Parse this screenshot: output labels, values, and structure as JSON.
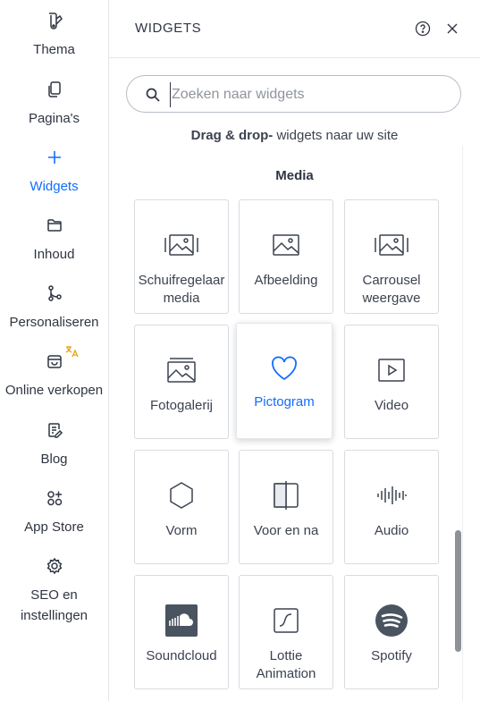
{
  "sidebar": {
    "items": [
      {
        "label": "Thema",
        "icon": "theme-icon"
      },
      {
        "label": "Pagina's",
        "icon": "pages-icon"
      },
      {
        "label": "Widgets",
        "icon": "plus-icon",
        "active": true
      },
      {
        "label": "Inhoud",
        "icon": "folder-icon"
      },
      {
        "label": "Personaliseren",
        "icon": "branch-icon"
      },
      {
        "label": "Online verkopen",
        "icon": "store-icon"
      },
      {
        "label": "Blog",
        "icon": "blog-icon"
      },
      {
        "label": "App Store",
        "icon": "apps-icon"
      },
      {
        "label": "SEO en instellingen",
        "icon": "gear-icon"
      }
    ]
  },
  "panel": {
    "title": "WIDGETS",
    "search_placeholder": "Zoeken naar widgets",
    "hint_bold": "Drag & drop-",
    "hint_rest": " widgets naar uw site",
    "section_title": "Media",
    "widgets": [
      {
        "label": "Schuifregelaar media",
        "icon": "slider-media-icon"
      },
      {
        "label": "Afbeelding",
        "icon": "image-icon"
      },
      {
        "label": "Carrousel weergave",
        "icon": "carousel-icon"
      },
      {
        "label": "Fotogalerij",
        "icon": "gallery-icon"
      },
      {
        "label": "Pictogram",
        "icon": "heart-icon",
        "selected": true
      },
      {
        "label": "Video",
        "icon": "video-icon"
      },
      {
        "label": "Vorm",
        "icon": "hexagon-icon"
      },
      {
        "label": "Voor en na",
        "icon": "before-after-icon"
      },
      {
        "label": "Audio",
        "icon": "audio-icon"
      },
      {
        "label": "Soundcloud",
        "icon": "soundcloud-icon"
      },
      {
        "label": "Lottie Animation",
        "icon": "lottie-icon"
      },
      {
        "label": "Spotify",
        "icon": "spotify-icon"
      }
    ]
  },
  "colors": {
    "accent": "#116dff",
    "text": "#2f3542",
    "border": "#d8dbe0"
  }
}
